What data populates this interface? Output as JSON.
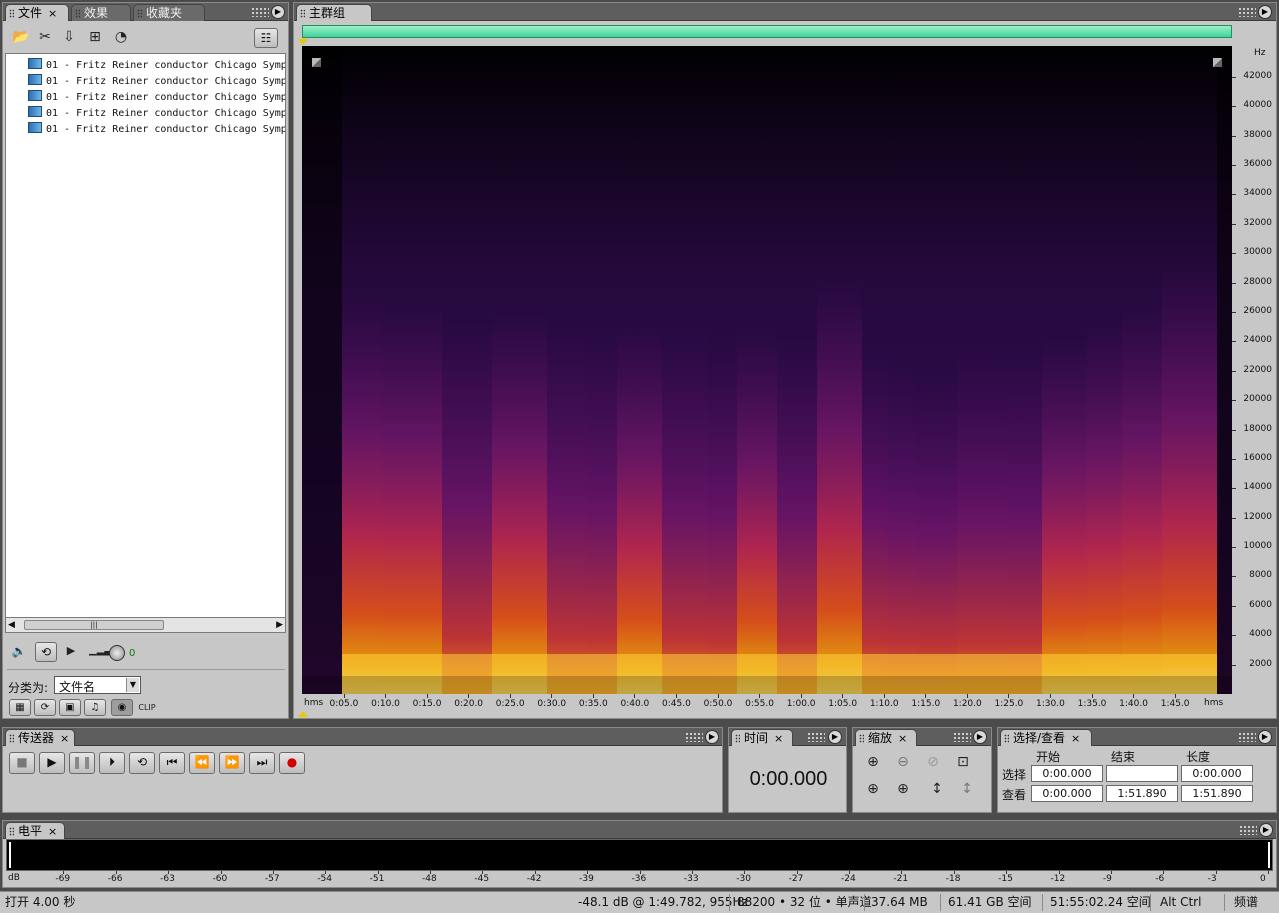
{
  "files_panel": {
    "tabs": [
      "文件",
      "效果",
      "收藏夹"
    ],
    "files": [
      "01 - Fritz Reiner conductor Chicago Symp",
      "01 - Fritz Reiner conductor Chicago Symp",
      "01 - Fritz Reiner conductor Chicago Symp",
      "01 - Fritz Reiner conductor Chicago Symp",
      "01 - Fritz Reiner conductor Chicago Symp"
    ],
    "volume_value": "0",
    "sort_label": "分类为:",
    "sort_value": "文件名"
  },
  "main_panel": {
    "tab": "主群组",
    "freq_unit": "Hz",
    "freq_ticks": [
      "42000",
      "40000",
      "38000",
      "36000",
      "34000",
      "32000",
      "30000",
      "28000",
      "26000",
      "24000",
      "22000",
      "20000",
      "18000",
      "16000",
      "14000",
      "12000",
      "10000",
      "8000",
      "6000",
      "4000",
      "2000"
    ],
    "time_unit": "hms",
    "time_ticks": [
      "0:05.0",
      "0:10.0",
      "0:15.0",
      "0:20.0",
      "0:25.0",
      "0:30.0",
      "0:35.0",
      "0:40.0",
      "0:45.0",
      "0:50.0",
      "0:55.0",
      "1:00.0",
      "1:05.0",
      "1:10.0",
      "1:15.0",
      "1:20.0",
      "1:25.0",
      "1:30.0",
      "1:35.0",
      "1:40.0",
      "1:45.0"
    ]
  },
  "transport": {
    "tab": "传送器"
  },
  "time_panel": {
    "tab": "时间",
    "value": "0:00.000"
  },
  "zoom_panel": {
    "tab": "缩放"
  },
  "selection_panel": {
    "tab": "选择/查看",
    "headers": [
      "开始",
      "结束",
      "长度"
    ],
    "rows": [
      {
        "label": "选择",
        "start": "0:00.000",
        "end": "",
        "length": "0:00.000"
      },
      {
        "label": "查看",
        "start": "0:00.000",
        "end": "1:51.890",
        "length": "1:51.890"
      }
    ]
  },
  "level_panel": {
    "tab": "电平",
    "unit": "dB",
    "ticks": [
      "-69",
      "-66",
      "-63",
      "-60",
      "-57",
      "-54",
      "-51",
      "-48",
      "-45",
      "-42",
      "-39",
      "-36",
      "-33",
      "-30",
      "-27",
      "-24",
      "-21",
      "-18",
      "-15",
      "-12",
      "-9",
      "-6",
      "-3",
      "0"
    ]
  },
  "status_bar": {
    "open_time": "打开 4.00 秒",
    "cursor_info": "-48.1 dB @  1:49.782, 955Hz",
    "format": "88200 • 32 位 • 单声道",
    "file_size": "37.64 MB",
    "disk_space": "61.41 GB 空间",
    "time_free": "51:55:02.24 空间",
    "modifier": "Alt Ctrl",
    "view_mode": "频谱"
  }
}
